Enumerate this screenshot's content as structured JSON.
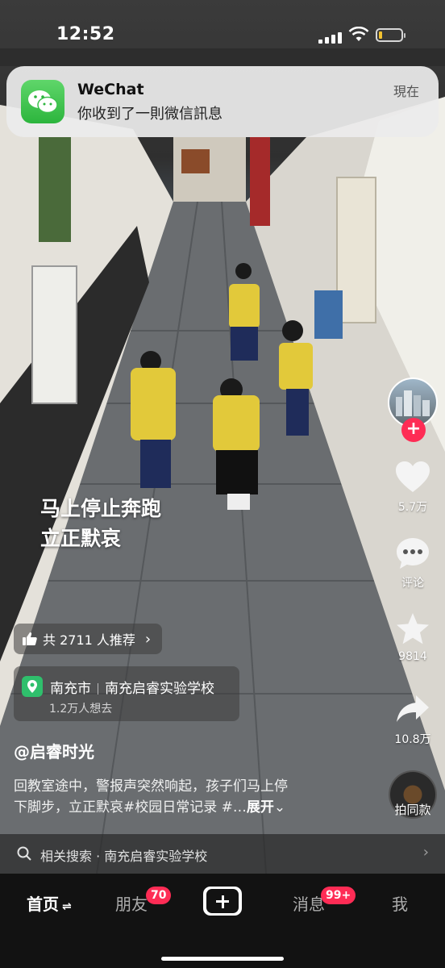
{
  "status_bar": {
    "time": "12:52",
    "battery_level": 0.15
  },
  "notification": {
    "app_name": "WeChat",
    "message": "你收到了一則微信訊息",
    "time": "現在",
    "icon": "wechat-icon"
  },
  "video": {
    "caption_line1": "马上停止奔跑",
    "caption_line2": "立正默哀"
  },
  "recommend": {
    "text": "共 2711 人推荐",
    "icon": "thumbs-up-icon"
  },
  "location": {
    "city": "南充市",
    "place": "南充启睿实验学校",
    "wants": "1.2万人想去",
    "icon": "map-pin-icon"
  },
  "author": {
    "handle": "@启睿时光"
  },
  "description": {
    "line1": "回教室途中，警报声突然响起，孩子们马上停",
    "line2_prefix": "下脚步，立正默哀#校园日常记录 #…",
    "expand": "展开"
  },
  "related_search": {
    "label": "相关搜索",
    "separator": "·",
    "query": "南充启睿实验学校"
  },
  "rail": {
    "likes": "5.7万",
    "comments_label": "评论",
    "favorites": "9814",
    "shares": "10.8万",
    "same_style": "拍同款"
  },
  "bottom_nav": {
    "home": "首页",
    "friends": "朋友",
    "friends_badge": "70",
    "messages": "消息",
    "messages_badge": "99+",
    "me": "我"
  },
  "colors": {
    "accent": "#fe2c55",
    "wechat_green": "#2cb53d",
    "location_green": "#2fbf6c"
  }
}
